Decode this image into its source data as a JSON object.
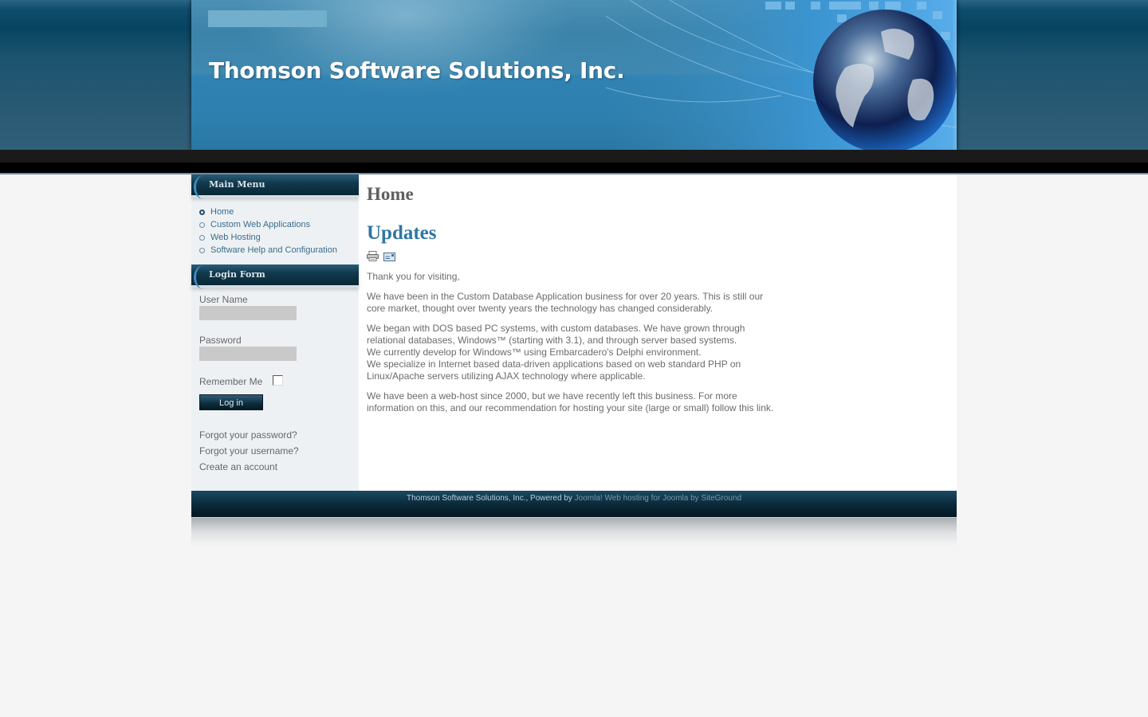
{
  "header": {
    "site_title": "Thomson Software Solutions, Inc.",
    "search_placeholder": ""
  },
  "sidebar": {
    "main_menu": {
      "title": "Main Menu",
      "items": [
        {
          "label": "Home",
          "active": true
        },
        {
          "label": "Custom Web Applications",
          "active": false
        },
        {
          "label": "Web Hosting",
          "active": false
        },
        {
          "label": "Software Help and Configuration",
          "active": false
        }
      ]
    },
    "login_form": {
      "title": "Login Form",
      "username_label": "User Name",
      "username_value": "",
      "password_label": "Password",
      "password_value": "",
      "remember_label": "Remember Me",
      "remember_checked": false,
      "login_button": "Log in",
      "links": [
        "Forgot your password?",
        "Forgot your username?",
        "Create an account"
      ]
    }
  },
  "content": {
    "page_heading": "Home",
    "article_title": "Updates",
    "icons": [
      "print-icon",
      "email-icon"
    ],
    "paragraphs": [
      "Thank you for visiting,",
      "We have been in the Custom Database Application business for over 20 years.  This is still our core market, thought over twenty years the technology has changed considerably.",
      "We began with DOS based PC systems, with custom databases.  We have grown through relational databases, Windows™ (starting with 3.1), and through server based systems.\nWe currently develop for Windows™ using Embarcadero's Delphi environment.\nWe specialize in Internet based data-driven applications based on web standard PHP on Linux/Apache servers utilizing AJAX technology where applicable.",
      "We have been a web-host since 2000, but we have recently left this business.  For more information on this, and our recommendation for hosting your site (large or small) follow this link."
    ]
  },
  "footer": {
    "text": "Thomson Software Solutions, Inc., Powered by ",
    "link1": "Joomla!",
    "link2": "Web hosting for Joomla by SiteGround"
  },
  "colors": {
    "accent_blue": "#2f76a3",
    "header_blue": "#2d7fae",
    "dark_navy": "#0b2b3b"
  }
}
